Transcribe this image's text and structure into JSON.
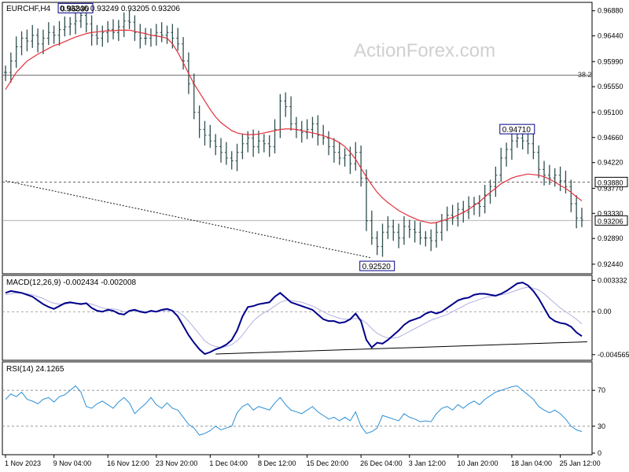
{
  "chart_data": {
    "type": "line",
    "symbol": "EURCHF,H4",
    "header_ohlc": "0.93246 0.93249 0.93205 0.93206",
    "watermark": "ActionForex.com",
    "colors": {
      "price": "#2f4f4f",
      "ma": "#e0303a",
      "macd": "#00008b",
      "signal": "#b0b0e0",
      "rsi": "#2b8fd6",
      "grid": "#888888",
      "axis": "#000000",
      "watermark": "#d0d0d0"
    },
    "x_labels": [
      "1 Nov 2023",
      "9 Nov 04:00",
      "16 Nov 12:00",
      "23 Nov 20:00",
      "1 Dec 04:00",
      "8 Dec 12:00",
      "15 Dec 20:00",
      "26 Dec 04:00",
      "3 Jan 12:00",
      "10 Jan 20:00",
      "18 Jan 04:00",
      "25 Jan 12:00"
    ],
    "price_panel": {
      "y_ticks": [
        "0.96880",
        "0.96440",
        "0.95990",
        "0.95550",
        "0.95100",
        "0.94660",
        "0.94220",
        "0.93770",
        "0.93330",
        "0.92890",
        "0.92440"
      ],
      "ylim": [
        0.923,
        0.97
      ],
      "close": [
        0.958,
        0.96,
        0.9625,
        0.964,
        0.9635,
        0.9645,
        0.963,
        0.964,
        0.965,
        0.9645,
        0.9655,
        0.966,
        0.9665,
        0.967,
        0.968,
        0.9665,
        0.9645,
        0.964,
        0.965,
        0.9655,
        0.965,
        0.966,
        0.967,
        0.9668,
        0.965,
        0.964,
        0.964,
        0.9645,
        0.965,
        0.9645,
        0.965,
        0.964,
        0.963,
        0.96,
        0.956,
        0.951,
        0.948,
        0.947,
        0.946,
        0.945,
        0.944,
        0.943,
        0.9425,
        0.944,
        0.9455,
        0.9465,
        0.945,
        0.946,
        0.9455,
        0.945,
        0.948,
        0.953,
        0.952,
        0.949,
        0.948,
        0.9475,
        0.948,
        0.949,
        0.947,
        0.9465,
        0.945,
        0.944,
        0.943,
        0.9435,
        0.942,
        0.944,
        0.9395,
        0.932,
        0.929,
        0.9275,
        0.93,
        0.931,
        0.93,
        0.929,
        0.931,
        0.9305,
        0.93,
        0.929,
        0.929,
        0.9285,
        0.93,
        0.932,
        0.933,
        0.9325,
        0.934,
        0.9335,
        0.9345,
        0.935,
        0.9345,
        0.9365,
        0.938,
        0.94,
        0.943,
        0.9445,
        0.946,
        0.9465,
        0.946,
        0.9455,
        0.944,
        0.941,
        0.94,
        0.9395,
        0.94,
        0.939,
        0.938,
        0.935,
        0.9325,
        0.9321
      ],
      "ma": [
        0.955,
        0.9565,
        0.958,
        0.959,
        0.96,
        0.9606,
        0.9612,
        0.9617,
        0.9622,
        0.9627,
        0.963,
        0.9634,
        0.9638,
        0.9642,
        0.9645,
        0.9648,
        0.965,
        0.9651,
        0.9652,
        0.9653,
        0.9653,
        0.9654,
        0.9654,
        0.9654,
        0.9652,
        0.965,
        0.9648,
        0.9645,
        0.9644,
        0.9642,
        0.964,
        0.963,
        0.9615,
        0.9597,
        0.9578,
        0.956,
        0.9545,
        0.953,
        0.9515,
        0.9502,
        0.9492,
        0.9485,
        0.9478,
        0.9474,
        0.9472,
        0.9471,
        0.9471,
        0.9472,
        0.9474,
        0.9476,
        0.9478,
        0.948,
        0.9481,
        0.9481,
        0.948,
        0.9478,
        0.9476,
        0.9474,
        0.9472,
        0.9469,
        0.9466,
        0.9462,
        0.9457,
        0.945,
        0.944,
        0.9428,
        0.9412,
        0.9397,
        0.9383,
        0.937,
        0.936,
        0.9352,
        0.9345,
        0.9338,
        0.9333,
        0.9328,
        0.9324,
        0.932,
        0.9318,
        0.9316,
        0.9317,
        0.932,
        0.9323,
        0.9326,
        0.933,
        0.9335,
        0.934,
        0.9347,
        0.9353,
        0.9362,
        0.937,
        0.9377,
        0.9385,
        0.939,
        0.9395,
        0.9398,
        0.94,
        0.9402,
        0.9401,
        0.94,
        0.9397,
        0.9393,
        0.9388,
        0.9382,
        0.9377,
        0.937,
        0.9362,
        0.9355
      ],
      "fib_level": 0.9575,
      "fib_label": "38.2",
      "dashed_level": 0.9388,
      "current_level": 0.93206,
      "trend_start": [
        0,
        0.939
      ],
      "trend_end": [
        68,
        0.9255
      ],
      "callouts": [
        {
          "text": "0.96830",
          "index": 13,
          "value": 0.9683
        },
        {
          "text": "0.92520",
          "index": 69,
          "value": 0.9252
        },
        {
          "text": "0.94710",
          "index": 95,
          "value": 0.9471
        }
      ],
      "axis_boxes": [
        {
          "text": "0.93880",
          "value": 0.9388
        },
        {
          "text": "0.93206",
          "value": 0.93206
        }
      ]
    },
    "macd_panel": {
      "label": "MACD(12,26,9) -0.002434 -0.002008",
      "y_ticks": [
        "0.003332",
        "0.00",
        "-0.004565"
      ],
      "ylim": [
        -0.005,
        0.0037
      ],
      "macd": [
        0.002,
        0.0022,
        0.0021,
        0.002,
        0.0018,
        0.0016,
        0.0012,
        0.0008,
        0.0005,
        0.0003,
        0.0006,
        0.0009,
        0.001,
        0.0009,
        0.0008,
        0.0009,
        0.0004,
        0.0001,
        0.0,
        0.0002,
        0.0001,
        -0.0002,
        -0.0003,
        0.0001,
        0.0002,
        0.0,
        -0.0001,
        0.0001,
        0.0,
        0.0002,
        0.0003,
        0.0001,
        -0.0005,
        -0.0015,
        -0.0025,
        -0.0033,
        -0.004,
        -0.0045,
        -0.0043,
        -0.004,
        -0.0038,
        -0.0035,
        -0.003,
        -0.002,
        -0.0005,
        0.0005,
        0.0006,
        0.0008,
        0.0009,
        0.001,
        0.0016,
        0.002,
        0.0015,
        0.001,
        0.0008,
        0.0006,
        0.0004,
        0.0002,
        -0.0003,
        -0.0008,
        -0.001,
        -0.001,
        -0.0012,
        -0.0011,
        -0.0008,
        -0.0002,
        -0.001,
        -0.003,
        -0.0038,
        -0.0033,
        -0.0034,
        -0.003,
        -0.0025,
        -0.002,
        -0.0014,
        -0.001,
        -0.0008,
        -0.0006,
        -0.0002,
        0.0,
        -0.0002,
        0.0,
        0.0004,
        0.0008,
        0.0012,
        0.0014,
        0.0015,
        0.0018,
        0.0019,
        0.0019,
        0.0018,
        0.0017,
        0.0019,
        0.0022,
        0.0026,
        0.003,
        0.0031,
        0.0028,
        0.0022,
        0.0014,
        0.0004,
        -0.0006,
        -0.001,
        -0.0012,
        -0.0013,
        -0.0016,
        -0.0022,
        -0.0026
      ],
      "signal": [
        0.0018,
        0.0019,
        0.002,
        0.002,
        0.0019,
        0.0018,
        0.0016,
        0.0014,
        0.0011,
        0.0009,
        0.0008,
        0.0008,
        0.0009,
        0.0009,
        0.0009,
        0.0009,
        0.0008,
        0.0006,
        0.0004,
        0.0003,
        0.0003,
        0.0002,
        0.0,
        0.0,
        0.0001,
        0.0001,
        0.0,
        0.0,
        0.0,
        0.0001,
        0.0001,
        0.0001,
        0.0,
        -0.0004,
        -0.001,
        -0.0017,
        -0.0024,
        -0.0031,
        -0.0035,
        -0.0037,
        -0.0038,
        -0.0037,
        -0.0035,
        -0.0031,
        -0.0025,
        -0.0017,
        -0.001,
        -0.0005,
        -0.0001,
        0.0002,
        0.0006,
        0.001,
        0.0012,
        0.0012,
        0.0011,
        0.001,
        0.0008,
        0.0006,
        0.0003,
        0.0,
        -0.0003,
        -0.0005,
        -0.0007,
        -0.0008,
        -0.0008,
        -0.0007,
        -0.0008,
        -0.0012,
        -0.0018,
        -0.0023,
        -0.0026,
        -0.0028,
        -0.0028,
        -0.0027,
        -0.0024,
        -0.0021,
        -0.0018,
        -0.0015,
        -0.0012,
        -0.0009,
        -0.0007,
        -0.0005,
        -0.0003,
        0.0,
        0.0003,
        0.0006,
        0.0009,
        0.0011,
        0.0013,
        0.0015,
        0.0016,
        0.0017,
        0.0018,
        0.0019,
        0.0021,
        0.0023,
        0.0025,
        0.0026,
        0.0025,
        0.0023,
        0.0019,
        0.0014,
        0.0009,
        0.0004,
        0.0,
        -0.0004,
        -0.0008,
        -0.0013
      ],
      "trend_start": [
        39,
        -0.0045
      ],
      "trend_end": [
        108,
        -0.0032
      ]
    },
    "rsi_panel": {
      "label": "RSI(14) 24.1265",
      "y_ticks": [
        "70",
        "30",
        "0"
      ],
      "ylim": [
        0,
        100
      ],
      "levels": [
        70,
        30
      ],
      "rsi": [
        60,
        66,
        63,
        68,
        60,
        58,
        55,
        60,
        62,
        57,
        63,
        65,
        70,
        75,
        68,
        52,
        50,
        55,
        58,
        54,
        50,
        57,
        62,
        56,
        44,
        50,
        55,
        62,
        54,
        50,
        56,
        50,
        48,
        40,
        32,
        28,
        20,
        22,
        25,
        30,
        26,
        28,
        30,
        45,
        52,
        55,
        48,
        52,
        50,
        48,
        56,
        62,
        54,
        48,
        46,
        44,
        48,
        52,
        46,
        42,
        38,
        40,
        36,
        40,
        36,
        46,
        30,
        22,
        24,
        28,
        42,
        40,
        38,
        36,
        44,
        40,
        38,
        35,
        36,
        35,
        44,
        50,
        52,
        48,
        54,
        50,
        55,
        58,
        54,
        60,
        64,
        68,
        70,
        72,
        74,
        75,
        70,
        65,
        60,
        52,
        48,
        45,
        48,
        44,
        38,
        30,
        26,
        24
      ]
    }
  }
}
